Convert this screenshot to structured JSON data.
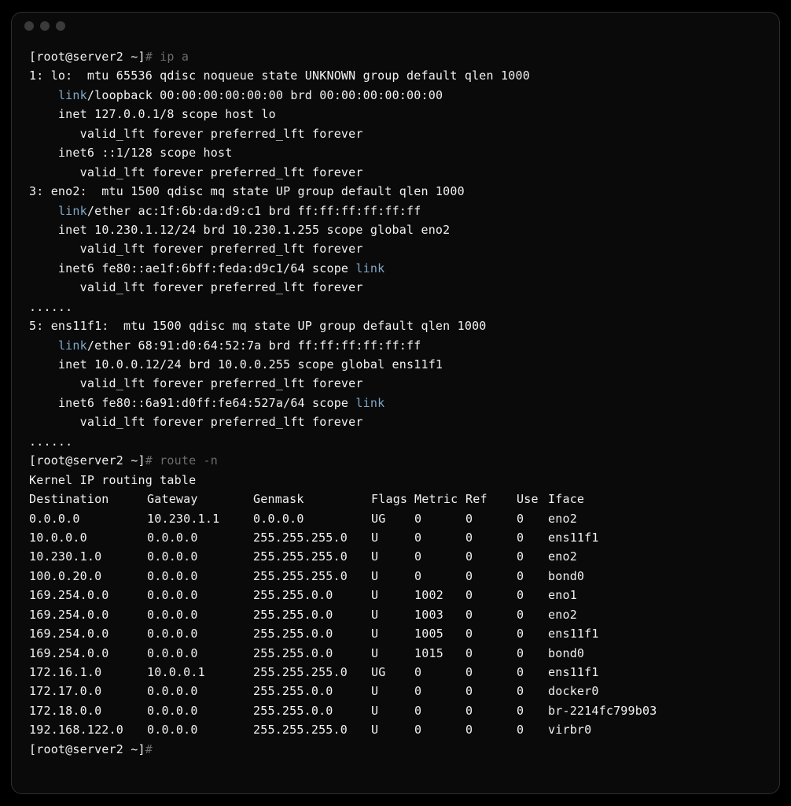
{
  "prompt1": {
    "user_host": "[root@server2 ~]",
    "hash": "#",
    "cmd": "ip a"
  },
  "ipa": {
    "lo": {
      "head": "1: lo:  mtu 65536 qdisc noqueue state UNKNOWN group default qlen 1000",
      "linkword": "link",
      "linkrest": "/loopback 00:00:00:00:00:00 brd 00:00:00:00:00:00",
      "inet": "inet 127.0.0.1/8 scope host lo",
      "valid1": "valid_lft forever preferred_lft forever",
      "inet6": "inet6 ::1/128 scope host",
      "valid2": "valid_lft forever preferred_lft forever"
    },
    "eno2": {
      "head": "3: eno2:  mtu 1500 qdisc mq state UP group default qlen 1000",
      "linkword": "link",
      "linkrest": "/ether ac:1f:6b:da:d9:c1 brd ff:ff:ff:ff:ff:ff",
      "inet": "inet 10.230.1.12/24 brd 10.230.1.255 scope global eno2",
      "valid1": "valid_lft forever preferred_lft forever",
      "inet6pre": "inet6 fe80::ae1f:6bff:feda:d9c1/64 scope ",
      "inet6link": "link",
      "valid2": "valid_lft forever preferred_lft forever"
    },
    "dots1": "......",
    "ens11f1": {
      "head": "5: ens11f1:  mtu 1500 qdisc mq state UP group default qlen 1000",
      "linkword": "link",
      "linkrest": "/ether 68:91:d0:64:52:7a brd ff:ff:ff:ff:ff:ff",
      "inet": "inet 10.0.0.12/24 brd 10.0.0.255 scope global ens11f1",
      "valid1": "valid_lft forever preferred_lft forever",
      "inet6pre": "inet6 fe80::6a91:d0ff:fe64:527a/64 scope ",
      "inet6link": "link",
      "valid2": "valid_lft forever preferred_lft forever"
    },
    "dots2": "......"
  },
  "prompt2": {
    "user_host": "[root@server2 ~]",
    "hash": "#",
    "cmd": "route -n"
  },
  "route": {
    "title": "Kernel IP routing table",
    "headers": {
      "dest": "Destination",
      "gw": "Gateway",
      "mask": "Genmask",
      "flags": "Flags",
      "metric": "Metric",
      "ref": "Ref",
      "use": "Use",
      "iface": "Iface"
    },
    "rows": [
      {
        "dest": "0.0.0.0",
        "gw": "10.230.1.1",
        "mask": "0.0.0.0",
        "flags": "UG",
        "metric": "0",
        "ref": "0",
        "use": "0",
        "iface": "eno2"
      },
      {
        "dest": "10.0.0.0",
        "gw": "0.0.0.0",
        "mask": "255.255.255.0",
        "flags": "U",
        "metric": "0",
        "ref": "0",
        "use": "0",
        "iface": "ens11f1"
      },
      {
        "dest": "10.230.1.0",
        "gw": "0.0.0.0",
        "mask": "255.255.255.0",
        "flags": "U",
        "metric": "0",
        "ref": "0",
        "use": "0",
        "iface": "eno2"
      },
      {
        "dest": "100.0.20.0",
        "gw": "0.0.0.0",
        "mask": "255.255.255.0",
        "flags": "U",
        "metric": "0",
        "ref": "0",
        "use": "0",
        "iface": "bond0"
      },
      {
        "dest": "169.254.0.0",
        "gw": "0.0.0.0",
        "mask": "255.255.0.0",
        "flags": "U",
        "metric": "1002",
        "ref": "0",
        "use": "0",
        "iface": "eno1"
      },
      {
        "dest": "169.254.0.0",
        "gw": "0.0.0.0",
        "mask": "255.255.0.0",
        "flags": "U",
        "metric": "1003",
        "ref": "0",
        "use": "0",
        "iface": "eno2"
      },
      {
        "dest": "169.254.0.0",
        "gw": "0.0.0.0",
        "mask": "255.255.0.0",
        "flags": "U",
        "metric": "1005",
        "ref": "0",
        "use": "0",
        "iface": "ens11f1"
      },
      {
        "dest": "169.254.0.0",
        "gw": "0.0.0.0",
        "mask": "255.255.0.0",
        "flags": "U",
        "metric": "1015",
        "ref": "0",
        "use": "0",
        "iface": "bond0"
      },
      {
        "dest": "172.16.1.0",
        "gw": "10.0.0.1",
        "mask": "255.255.255.0",
        "flags": "UG",
        "metric": "0",
        "ref": "0",
        "use": "0",
        "iface": "ens11f1"
      },
      {
        "dest": "172.17.0.0",
        "gw": "0.0.0.0",
        "mask": "255.255.0.0",
        "flags": "U",
        "metric": "0",
        "ref": "0",
        "use": "0",
        "iface": "docker0"
      },
      {
        "dest": "172.18.0.0",
        "gw": "0.0.0.0",
        "mask": "255.255.0.0",
        "flags": "U",
        "metric": "0",
        "ref": "0",
        "use": "0",
        "iface": "br-2214fc799b03"
      },
      {
        "dest": "192.168.122.0",
        "gw": "0.0.0.0",
        "mask": "255.255.255.0",
        "flags": "U",
        "metric": "0",
        "ref": "0",
        "use": "0",
        "iface": "virbr0"
      }
    ]
  },
  "prompt3": {
    "user_host": "[root@server2 ~]",
    "hash": "#"
  }
}
